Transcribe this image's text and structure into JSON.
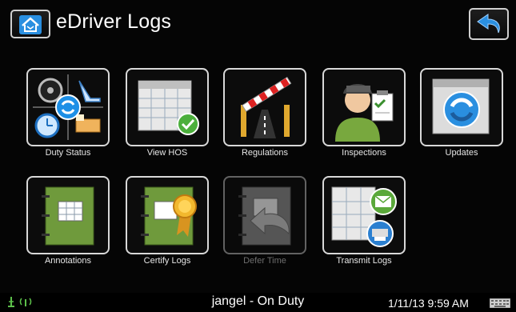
{
  "header": {
    "title": "eDriver Logs",
    "home_icon": "home-icon",
    "back_icon": "back-arrow-icon"
  },
  "tiles": [
    {
      "label": "Duty Status",
      "icon": "duty-status-icon",
      "enabled": true
    },
    {
      "label": "View HOS",
      "icon": "calendar-check-icon",
      "enabled": true
    },
    {
      "label": "Regulations",
      "icon": "road-barrier-icon",
      "enabled": true
    },
    {
      "label": "Inspections",
      "icon": "inspector-clipboard-icon",
      "enabled": true
    },
    {
      "label": "Updates",
      "icon": "refresh-calendar-icon",
      "enabled": true
    },
    {
      "label": "Annotations",
      "icon": "notebook-icon",
      "enabled": true
    },
    {
      "label": "Certify Logs",
      "icon": "notebook-ribbon-icon",
      "enabled": true
    },
    {
      "label": "Defer Time",
      "icon": "notebook-arrow-icon",
      "enabled": false
    },
    {
      "label": "Transmit Logs",
      "icon": "email-printer-icon",
      "enabled": true
    }
  ],
  "status_bar": {
    "user_status": "jangel - On Duty",
    "datetime": "1/11/13 9:59 AM",
    "signal_icon": "signal-antenna-icon",
    "keyboard_icon": "keyboard-icon"
  },
  "colors": {
    "accent_blue": "#2a8fe0",
    "notebook_green": "#6f9a3c",
    "tile_border": "#d8d8d8",
    "background": "#000000"
  }
}
